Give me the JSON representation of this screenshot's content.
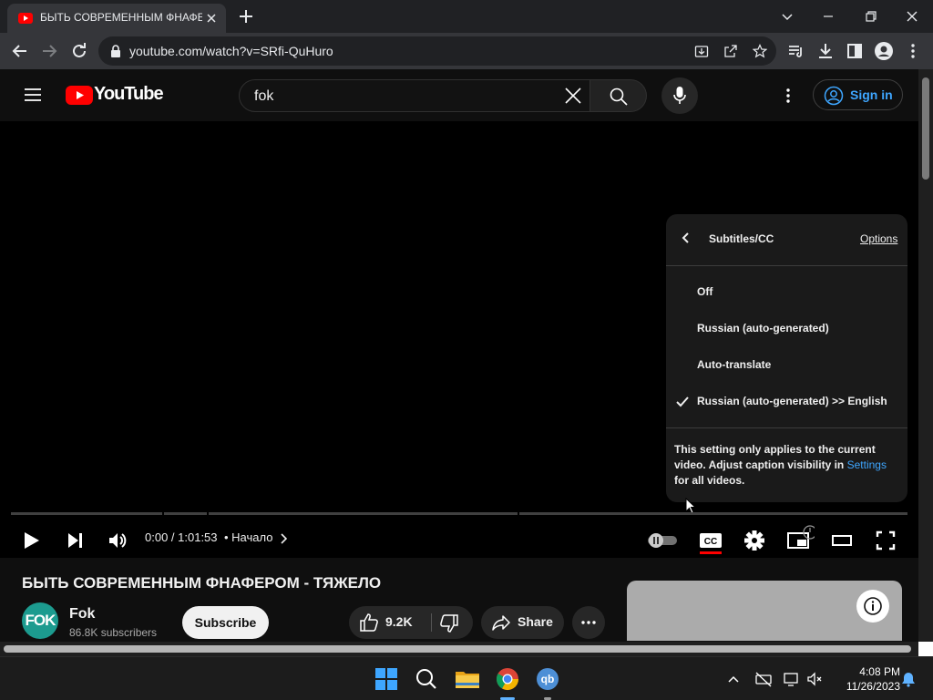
{
  "browser": {
    "tab_title": "БЫТЬ СОВРЕМЕННЫМ ФНАФЕРОМ - ТЯЖЕЛО",
    "url": "youtube.com/watch?v=SRfi-QuHuro"
  },
  "youtube": {
    "logo_text": "YouTube",
    "search_query": "fok",
    "sign_in_label": "Sign in"
  },
  "player": {
    "time_display": "0:00 / 1:01:53",
    "chapter_label": "• Начало",
    "progress": 0.0,
    "captions_menu": {
      "title": "Subtitles/CC",
      "options_link": "Options",
      "items": [
        {
          "label": "Off",
          "selected": false
        },
        {
          "label": "Russian (auto-generated)",
          "selected": false
        },
        {
          "label": "Auto-translate",
          "selected": false
        },
        {
          "label": "Russian (auto-generated) >> English",
          "selected": true
        }
      ],
      "note_text": "This setting only applies to the current video. Adjust caption visibility in",
      "note_link": "Settings",
      "note_tail": "for all videos."
    }
  },
  "video": {
    "title": "БЫТЬ СОВРЕМЕННЫМ ФНАФЕРОМ - ТЯЖЕЛО",
    "channel_name": "Fok",
    "channel_avatar_text": "FOK",
    "subscribers": "86.8K subscribers",
    "subscribe_label": "Subscribe",
    "like_count": "9.2K",
    "share_label": "Share"
  },
  "taskbar": {
    "time": "4:08 PM",
    "date": "11/26/2023"
  },
  "colors": {
    "accent_blue": "#3ea6ff",
    "youtube_red": "#ff0000",
    "page_bg": "#0f0f0f"
  }
}
